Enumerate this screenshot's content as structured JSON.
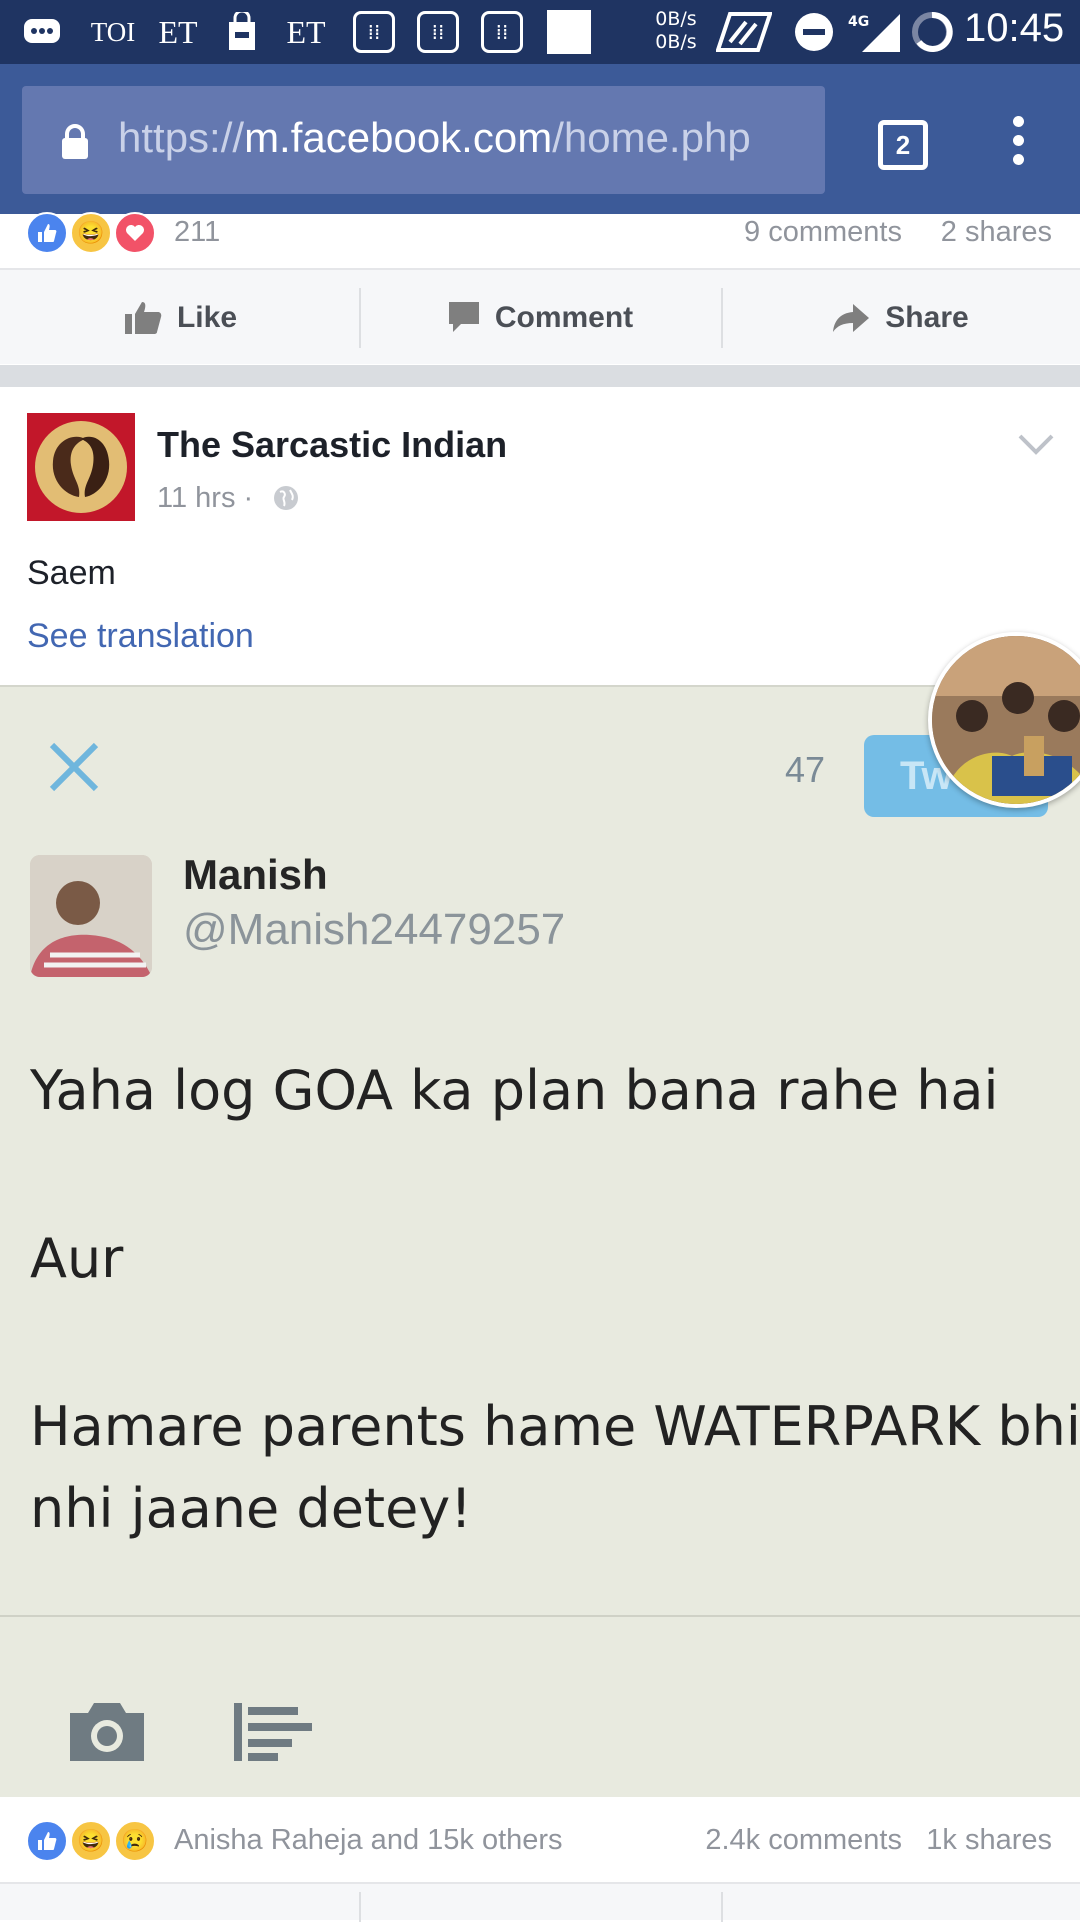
{
  "status_bar": {
    "notifications": [
      "TOI",
      "ET",
      "ET"
    ],
    "net_speed_up": "0B/s",
    "net_speed_down": "0B/s",
    "network": "4G",
    "time": "10:45"
  },
  "browser": {
    "url_scheme": "https://",
    "url_host": "m.facebook.com",
    "url_path": "/home.php",
    "tab_count": "2"
  },
  "prev_post": {
    "reaction_count": "211",
    "comments": "9 comments",
    "shares": "2 shares"
  },
  "actions": {
    "like": "Like",
    "comment": "Comment",
    "share": "Share"
  },
  "post": {
    "page_name": "The Sarcastic Indian",
    "time": "11 hrs ·",
    "text": "Saem",
    "see_translation": "See translation",
    "reactions_summary": "Anisha Raheja and 15k others",
    "comments": "2.4k comments",
    "shares": "1k shares"
  },
  "tweet": {
    "char_count": "47",
    "button": "Tw",
    "name": "Manish",
    "handle": "@Manish24479257",
    "line1": "Yaha log GOA ka plan bana rahe hai",
    "line2": "Aur",
    "line3": "Hamare parents hame WATERPARK bhi",
    "line4": "nhi jaane detey!"
  },
  "colors": {
    "status_bar": "#1f3462",
    "url_bar": "#3c5a98",
    "link": "#4267b2",
    "like_blue": "#4b84ee",
    "tweet_bg": "#e8eadf"
  }
}
